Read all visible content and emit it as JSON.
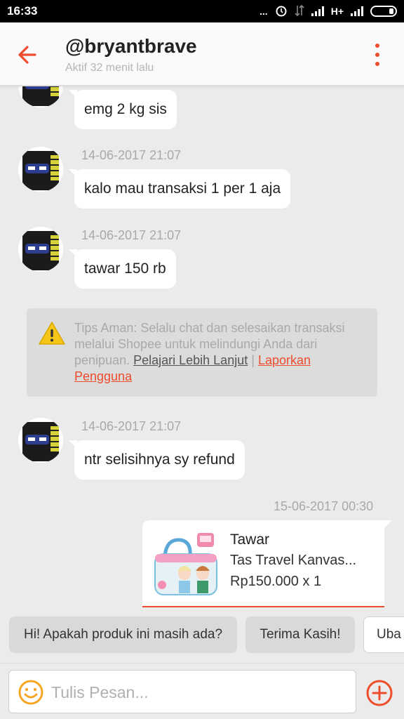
{
  "status_bar": {
    "time": "16:33",
    "dots": "...",
    "network": "H+"
  },
  "header": {
    "username": "@bryantbrave",
    "status": "Aktif 32 menit lalu"
  },
  "messages": [
    {
      "timestamp": "",
      "text": "emg 2 kg sis"
    },
    {
      "timestamp": "14-06-2017 21:07",
      "text": "kalo mau transaksi 1 per 1 aja"
    },
    {
      "timestamp": "14-06-2017 21:07",
      "text": "tawar 150 rb"
    },
    {
      "timestamp": "14-06-2017 21:07",
      "text": "ntr selisihnya sy refund"
    }
  ],
  "tips": {
    "text": "Tips Aman: Selalu chat dan selesaikan transaksi melalui Shopee untuk melindungi Anda dari penipuan.",
    "learn_more": "Pelajari Lebih Lanjut",
    "separator": "|",
    "report": "Laporkan Pengguna"
  },
  "offer": {
    "timestamp": "15-06-2017 00:30",
    "title": "Tawar",
    "product_name": "Tas Travel Kanvas...",
    "price": "Rp150.000 x 1"
  },
  "quick_replies": [
    "Hi! Apakah produk ini masih ada?",
    "Terima Kasih!",
    "Uba"
  ],
  "input": {
    "placeholder": "Tulis Pesan..."
  },
  "colors": {
    "accent": "#ee4d2d",
    "background": "#ebebeb"
  }
}
